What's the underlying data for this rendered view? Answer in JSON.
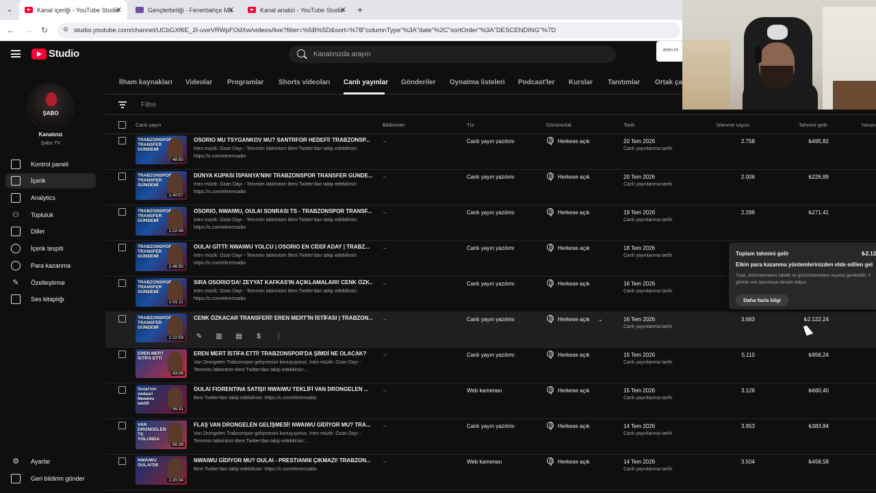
{
  "browser": {
    "tabs": [
      {
        "title": "Kanal içeriği - YouTube Studio",
        "active": true,
        "icon": "youtube-icon"
      },
      {
        "title": "Gençlerbirliği - Fenerbahçe Ma",
        "active": false,
        "icon": "site-icon"
      },
      {
        "title": "Kanal analizi - YouTube Studio",
        "active": false,
        "icon": "youtube-icon"
      }
    ],
    "new_tab": "+",
    "url": "studio.youtube.com/channel/UCbGXf6E_2I-uveVRWpFOdXw/videos/live?filter=%5B%5D&sort=%7B\"columnType\"%3A\"date\"%2C\"sortOrder\"%3A\"DESCENDING\"%7D"
  },
  "header": {
    "logo_text": "Studio",
    "search_placeholder": "Kanalınızda arayın",
    "popup_text": "eren m"
  },
  "sidebar": {
    "avatar_text": "ŞABO",
    "channel_label": "Kanalınız",
    "channel_name": "Şabo TV",
    "items": [
      {
        "label": "Kontrol paneli",
        "icon": "dashboard-icon",
        "active": false
      },
      {
        "label": "İçerik",
        "icon": "content-icon",
        "active": true
      },
      {
        "label": "Analytics",
        "icon": "analytics-icon",
        "active": false
      },
      {
        "label": "Topluluk",
        "icon": "community-icon",
        "active": false
      },
      {
        "label": "Diller",
        "icon": "subtitles-icon",
        "active": false
      },
      {
        "label": "İçerik tespiti",
        "icon": "copyright-icon",
        "active": false
      },
      {
        "label": "Para kazanma",
        "icon": "monetization-icon",
        "active": false
      },
      {
        "label": "Özelleştirme",
        "icon": "customization-icon",
        "active": false
      },
      {
        "label": "Ses kitaplığı",
        "icon": "audio-library-icon",
        "active": false
      }
    ],
    "settings": "Ayarlar",
    "feedback": "Geri bildirim gönder"
  },
  "content_tabs": [
    "İlham kaynakları",
    "Videolar",
    "Programlar",
    "Shorts videoları",
    "Canlı yayınlar",
    "Gönderiler",
    "Oynatma listeleri",
    "Podcast'ler",
    "Kurslar",
    "Tanıtımlar",
    "Ortak çal"
  ],
  "active_tab": "Canlı yayınlar",
  "filter": {
    "placeholder": "Filtre"
  },
  "columns": {
    "stream": "Canlı yayın",
    "restrictions": "Bildirimler",
    "type": "Tür",
    "visibility": "Görünürlük",
    "date": "Tarih",
    "views": "İzlenme sayısı",
    "revenue": "Tahmini gelir",
    "comments": "Yorum"
  },
  "rows": [
    {
      "title": "OSORIO MU TSYGANKOV MU? SANTRFOR HEDEFİ! TRABZONSP...",
      "desc": "Intro müzik: Ozan Dayı - Temmim labirintom Beni Twitter'dan takip edebilirsin: https://x.com/ekremsabo",
      "thumb_text": "TRABZONSPOR TRANSFER GÜNDEMİ",
      "duration": "48:50",
      "restriction": "–",
      "type": "Canlı yayın yazılımı",
      "visibility": "Herkese açık",
      "date": "20 Tem 2026",
      "date_sub": "Canlı yayınlanma tarihi",
      "views": "2.758",
      "revenue": "₺495,82"
    },
    {
      "title": "DÜNYA KUPASI İSPANYA'NIN! TRABZONSPOR TRANSFER GÜNDE...",
      "desc": "Intro müzik: Ozan Dayı - Temmim labirintom Beni Twitter'dan takip edebilirsin: https://x.com/ekremsabo",
      "thumb_text": "TRABZONSPOR TRANSFER GÜNDEMİ",
      "duration": "1:40:57",
      "restriction": "–",
      "type": "Canlı yayın yazılımı",
      "visibility": "Herkese açık",
      "date": "20 Tem 2026",
      "date_sub": "Canlı yayınlanma tarihi",
      "views": "2.006",
      "revenue": "₺226,89"
    },
    {
      "title": "OSORIO, NWAIWU, OULAI SONRASI TS - TRABZONSPOR TRANSF...",
      "desc": "Intro müzik: Ozan Dayı - Temmim labirintom Beni Twitter'dan takip edebilirsin: https://x.com/ekremsabo",
      "thumb_text": "TRABZONSPOR TRANSFER GÜNDEMİ",
      "duration": "1:22:49",
      "restriction": "–",
      "type": "Canlı yayın yazılımı",
      "visibility": "Herkese açık",
      "date": "19 Tem 2026",
      "date_sub": "Canlı yayınlanma tarihi",
      "views": "2.299",
      "revenue": "₺271,41"
    },
    {
      "title": "OULAI GİTTİ! NWAIWU YOLCU | OSORIO EN CİDDİ ADAY | TRABZ...",
      "desc": "Intro müzik: Ozan Dayı - Temmim labirintom Beni Twitter'dan takip edebilirsin: https://x.com/ekremsabo",
      "thumb_text": "TRABZONSPOR TRANSFER GÜNDEMİ",
      "duration": "1:46:50",
      "restriction": "–",
      "type": "Canlı yayın yazılımı",
      "visibility": "Herkese açık",
      "date": "18 Tem 2026",
      "date_sub": "Canlı yayınlanma tarihi",
      "views": "",
      "revenue": ""
    },
    {
      "title": "SIRA OSORIO'DA! ZEYYAT KAFKAS'IN AÇIKLAMALARI! CENK ÖZK...",
      "desc": "Intro müzik: Ozan Dayı - Temmim labirintom Beni Twitter'dan takip edebilirsin: https://x.com/ekremsabo",
      "thumb_text": "TRABZONSPOR TRANSFER GÜNDEMİ",
      "duration": "1:01:11",
      "restriction": "–",
      "type": "Canlı yayın yazılımı",
      "visibility": "Herkese açık",
      "date": "16 Tem 2026",
      "date_sub": "Canlı yayınlanma tarihi",
      "views": "",
      "revenue": ""
    },
    {
      "title": "CENK ÖZKACAR TRANSFERİ! EREN MERT'İN İSTİFASI | TRABZON...",
      "desc": "",
      "thumb_text": "TRABZONSPOR TRANSFER GÜNDEMİ",
      "duration": "1:22:59",
      "restriction": "–",
      "type": "Canlı yayın yazılımı",
      "visibility": "Herkese açık",
      "date": "16 Tem 2026",
      "date_sub": "Canlı yayınlanma tarihi",
      "views": "3.663",
      "revenue": "₺2.122,24",
      "hover": true
    },
    {
      "title": "EREN MERT İSTİFA ETTİ! TRABZONSPOR'DA ŞİMDİ NE OLACAK?",
      "desc": "Van Drongelen Trabzonspor gelişmesini konuşuyoruz. Intro müzik: Ozan Dayı - Temmim labirintom Beni Twitter'dan takip edebilirsin:...",
      "thumb_text": "EREN MERT İSTİFA ETTİ",
      "duration": "43:06",
      "restriction": "–",
      "type": "Canlı yayın yazılımı",
      "visibility": "Herkese açık",
      "date": "15 Tem 2026",
      "date_sub": "Canlı yayınlanma tarihi",
      "views": "5.110",
      "revenue": "₺956,24"
    },
    {
      "title": "OULAI FIORENTINA SATIŞI! NWAIWU TEKLİFİ VAN DRONGELEN ...",
      "desc": "Beni Twitter'dan takip edebilirsin: https://x.com/ekremsabo",
      "thumb_text": "Oulai'nin vedası! Nwaiwu teklifi",
      "duration": "56:31",
      "restriction": "–",
      "type": "Web kamerası",
      "visibility": "Herkese açık",
      "date": "15 Tem 2026",
      "date_sub": "Canlı yayınlanma tarihi",
      "views": "3.126",
      "revenue": "₺660,40"
    },
    {
      "title": "FLAŞ VAN DRONGELEN GELİŞMESİ! NWAIWU GİDİYOR MU? TRA...",
      "desc": "Van Drongelen Trabzonspor gelişmesini konuşuyoruz. Intro müzik: Ozan Dayı - Temmim labirintom Beni Twitter'dan takip edebilirsin:...",
      "thumb_text": "VAN DRONGELEN TS YOLUNDA",
      "duration": "56:39",
      "restriction": "–",
      "type": "Canlı yayın yazılımı",
      "visibility": "Herkese açık",
      "date": "14 Tem 2026",
      "date_sub": "Canlı yayınlanma tarihi",
      "views": "3.953",
      "revenue": "₺383,84"
    },
    {
      "title": "NWAIWU GİDİYOR MU? OULAI - PRESTIANNI ÇIKMAZI! TRABZON...",
      "desc": "Beni Twitter'dan takip edebilirsin: https://x.com/ekremsabo",
      "thumb_text": "NWAIWU OULAI'DE",
      "duration": "1:20:34",
      "restriction": "–",
      "type": "Web kamerası",
      "visibility": "Herkese açık",
      "date": "14 Tem 2026",
      "date_sub": "Canlı yayınlanma tarihi",
      "views": "3.504",
      "revenue": "₺458,58"
    }
  ],
  "tooltip": {
    "title": "Toplam tahmini gelir",
    "value": "₺2.12",
    "subtitle": "Etkin para kazanma yöntemlerinizden elde edilen gel",
    "note": "Tutar, düzenlemelere tabidir ve görüntülemelere kıyasla gecikebilir. 2 günlük veri işlenmeye devam ediyor.",
    "button": "Daha fazla bilgi"
  },
  "colors": {
    "accent": "#ff0033",
    "background": "#0f0f0f",
    "row_hover": "#1f1f1f"
  }
}
